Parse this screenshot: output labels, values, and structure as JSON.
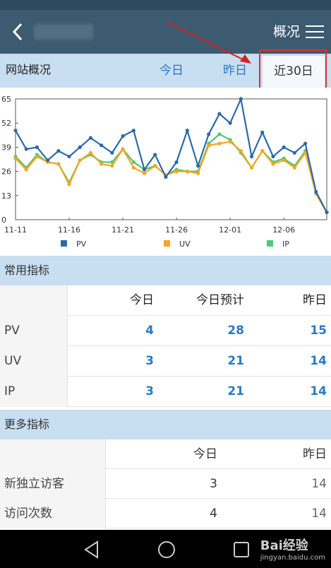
{
  "header": {
    "page_title": "概况"
  },
  "tabs": {
    "section_label": "网站概况",
    "today": "今日",
    "yesterday": "昨日",
    "last30": "近30日",
    "selected": "近30日"
  },
  "chart_data": {
    "type": "line",
    "x": [
      "11-11",
      "11-12",
      "11-13",
      "11-14",
      "11-15",
      "11-16",
      "11-17",
      "11-18",
      "11-19",
      "11-20",
      "11-21",
      "11-22",
      "11-23",
      "11-24",
      "11-25",
      "11-26",
      "11-27",
      "11-28",
      "11-29",
      "11-30",
      "12-01",
      "12-02",
      "12-03",
      "12-04",
      "12-05",
      "12-06",
      "12-07",
      "12-08",
      "12-09",
      "12-10"
    ],
    "xticks": [
      "11-11",
      "11-16",
      "11-21",
      "11-26",
      "12-01",
      "12-06"
    ],
    "yticks": [
      "0",
      "13",
      "26",
      "39",
      "52",
      "65"
    ],
    "ylim": [
      0,
      65
    ],
    "series": [
      {
        "name": "PV",
        "color": "#2c6aa8",
        "values": [
          48,
          38,
          39,
          32,
          37,
          34,
          39,
          44,
          40,
          36,
          45,
          48,
          27,
          35,
          23,
          31,
          48,
          29,
          46,
          57,
          52,
          65,
          34,
          47,
          34,
          39,
          36,
          41,
          15,
          4
        ]
      },
      {
        "name": "UV",
        "color": "#f5a623",
        "values": [
          33,
          27,
          34,
          31,
          30,
          19,
          32,
          36,
          30,
          29,
          38,
          28,
          25,
          29,
          24,
          26,
          26,
          25,
          40,
          41,
          42,
          37,
          28,
          37,
          30,
          32,
          28,
          36,
          14,
          4
        ]
      },
      {
        "name": "IP",
        "color": "#50c878",
        "values": [
          34,
          28,
          35,
          31,
          30,
          20,
          32,
          35,
          31,
          31,
          38,
          31,
          27,
          29,
          24,
          27,
          26,
          26,
          41,
          46,
          43,
          36,
          28,
          37,
          31,
          33,
          29,
          37,
          14,
          4
        ]
      }
    ],
    "legend_position": "bottom"
  },
  "common_metrics": {
    "title": "常用指标",
    "headers": [
      "今日",
      "今日预计",
      "昨日"
    ],
    "rows": [
      {
        "label": "PV",
        "values": [
          "4",
          "28",
          "15"
        ]
      },
      {
        "label": "UV",
        "values": [
          "3",
          "21",
          "14"
        ]
      },
      {
        "label": "IP",
        "values": [
          "3",
          "21",
          "14"
        ]
      }
    ]
  },
  "more_metrics": {
    "title": "更多指标",
    "headers": [
      "今日",
      "昨日"
    ],
    "rows": [
      {
        "label": "新独立访客",
        "values": [
          "3",
          "14"
        ]
      },
      {
        "label": "访问次数",
        "values": [
          "4",
          "14"
        ]
      }
    ]
  },
  "watermark": {
    "text": "Bai",
    "suffix": "经验",
    "url": "jingyan.baidu.com"
  },
  "icons": {
    "back": "chevron-left-icon",
    "menu": "hamburger-menu-icon",
    "nav_back": "triangle-back-icon",
    "nav_home": "circle-home-icon",
    "nav_recent": "square-recent-icon"
  },
  "colors": {
    "appbar": "#3d5b70",
    "band": "#c8def1",
    "accent": "#2a78c0",
    "highlight": "#e03030"
  }
}
